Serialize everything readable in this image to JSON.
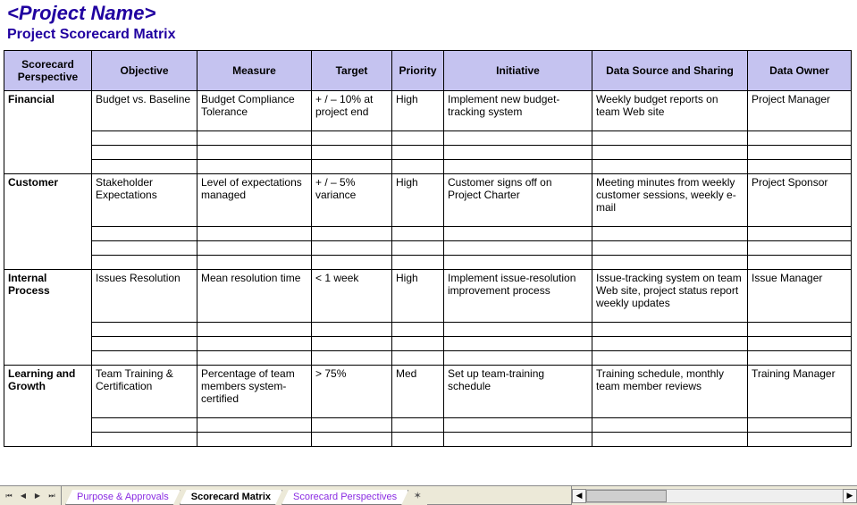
{
  "header": {
    "title": "<Project Name>",
    "subtitle": "Project Scorecard Matrix"
  },
  "columns": [
    "Scorecard Perspective",
    "Objective",
    "Measure",
    "Target",
    "Priority",
    "Initiative",
    "Data Source and Sharing",
    "Data Owner"
  ],
  "groups": [
    {
      "perspective": "Financial",
      "rows": [
        {
          "objective": "Budget vs. Baseline",
          "measure": "Budget Compliance Tolerance",
          "target": "+ / – 10% at project end",
          "priority": "High",
          "initiative": "Implement new budget-tracking system",
          "source": "Weekly budget reports on team Web site",
          "owner": "Project Manager"
        },
        {},
        {},
        {}
      ]
    },
    {
      "perspective": "Customer",
      "rows": [
        {
          "objective": "Stakeholder Expectations",
          "measure": "Level of expectations managed",
          "target": "+ / – 5% variance",
          "priority": "High",
          "initiative": "Customer signs off on Project Charter",
          "source": "Meeting minutes from weekly customer sessions, weekly e-mail",
          "owner": "Project Sponsor"
        },
        {},
        {},
        {}
      ]
    },
    {
      "perspective": "Internal Process",
      "rows": [
        {
          "objective": "Issues Resolution",
          "measure": "Mean resolution time",
          "target": "< 1 week",
          "priority": "High",
          "initiative": "Implement issue-resolution improvement process",
          "source": "Issue-tracking system on team Web site, project status report weekly updates",
          "owner": "Issue Manager"
        },
        {},
        {},
        {}
      ]
    },
    {
      "perspective": "Learning and Growth",
      "rows": [
        {
          "objective": "Team Training & Certification",
          "measure": "Percentage of team members system-certified",
          "target": "> 75%",
          "priority": "Med",
          "initiative": "Set up team-training schedule",
          "source": "Training schedule, monthly team member reviews",
          "owner": "Training Manager"
        },
        {},
        {}
      ]
    }
  ],
  "tabs": {
    "items": [
      "Purpose & Approvals",
      "Scorecard Matrix",
      "Scorecard Perspectives"
    ],
    "active_index": 1
  }
}
